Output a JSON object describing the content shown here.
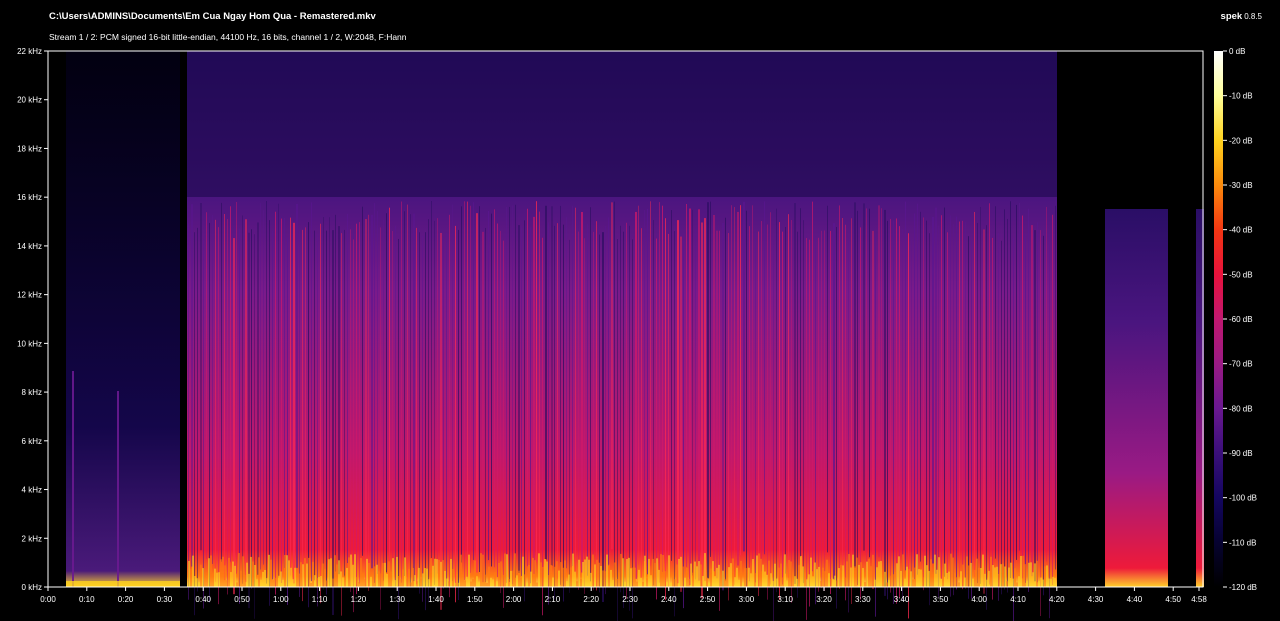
{
  "window": {
    "file_path": "C:\\Users\\ADMINS\\Documents\\Em Cua Ngay Hom Qua - Remastered.mkv",
    "stream_info": "Stream 1 / 2: PCM signed 16-bit little-endian, 44100 Hz, 16 bits, channel 1 / 2, W:2048, F:Hann",
    "app_name": "spek",
    "app_version": "0.8.5"
  },
  "frequency_axis": {
    "labels": [
      "0 kHz",
      "2 kHz",
      "4 kHz",
      "6 kHz",
      "8 kHz",
      "10 kHz",
      "12 kHz",
      "14 kHz",
      "16 kHz",
      "18 kHz",
      "20 kHz",
      "22 kHz"
    ]
  },
  "time_axis": {
    "labels": [
      "0:00",
      "0:10",
      "0:20",
      "0:30",
      "0:40",
      "0:50",
      "1:00",
      "1:10",
      "1:20",
      "1:30",
      "1:40",
      "1:50",
      "2:00",
      "2:10",
      "2:20",
      "2:30",
      "2:40",
      "2:50",
      "3:00",
      "3:10",
      "3:20",
      "3:30",
      "3:40",
      "3:50",
      "4:00",
      "4:10",
      "4:20",
      "4:30",
      "4:40",
      "4:50",
      "4:58"
    ]
  },
  "level_scale": {
    "labels": [
      "0 dB",
      "-10 dB",
      "-20 dB",
      "-30 dB",
      "-40 dB",
      "-50 dB",
      "-60 dB",
      "-70 dB",
      "-80 dB",
      "-90 dB",
      "-100 dB",
      "-110 dB",
      "-120 dB"
    ]
  },
  "colors": {
    "background": "#000000",
    "axis": "#ffffff",
    "palette": [
      "#000000",
      "#0a0233",
      "#2a0a6e",
      "#5a1590",
      "#8a1a8c",
      "#c01870",
      "#e8123c",
      "#f43612",
      "#fb8a0c",
      "#ffd21e",
      "#ffffc8",
      "#ffffff"
    ]
  }
}
